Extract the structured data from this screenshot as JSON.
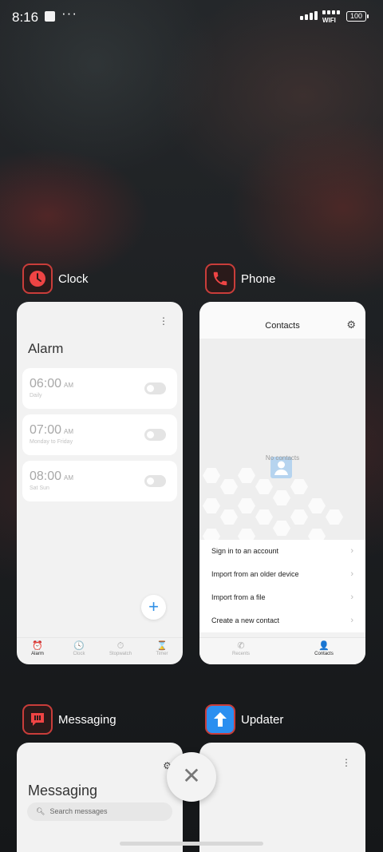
{
  "status_bar": {
    "time": "8:16",
    "more": "···",
    "wifi_label": "WIFI",
    "battery": "100"
  },
  "apps": {
    "clock": {
      "name": "Clock",
      "icon": "clock-icon",
      "icon_color": "#e9433f",
      "menu": "⋮",
      "title": "Alarm",
      "alarms": [
        {
          "time": "06:00",
          "ampm": "AM",
          "repeat": "Daily"
        },
        {
          "time": "07:00",
          "ampm": "AM",
          "repeat": "Monday to Friday"
        },
        {
          "time": "08:00",
          "ampm": "AM",
          "repeat": "Sat Sun"
        }
      ],
      "fab": "+",
      "nav": [
        {
          "label": "Alarm",
          "icon": "⏰"
        },
        {
          "label": "Clock",
          "icon": "🕓"
        },
        {
          "label": "Stopwatch",
          "icon": "⏱"
        },
        {
          "label": "Timer",
          "icon": "⌛"
        }
      ]
    },
    "phone": {
      "name": "Phone",
      "icon": "phone-icon",
      "icon_color": "#e9433f",
      "title": "Contacts",
      "gear": "⚙",
      "empty_text": "No contacts",
      "actions": [
        {
          "label": "Sign in to an account"
        },
        {
          "label": "Import from an older device"
        },
        {
          "label": "Import from a file"
        },
        {
          "label": "Create a new contact"
        }
      ],
      "nav": [
        {
          "label": "Recents",
          "icon": "✆"
        },
        {
          "label": "Contacts",
          "icon": "👤"
        }
      ]
    },
    "messaging": {
      "name": "Messaging",
      "icon": "message-icon",
      "icon_color": "#e9433f",
      "gear": "⚙",
      "title": "Messaging",
      "search_placeholder": "Search messages"
    },
    "updater": {
      "name": "Updater",
      "icon": "upload-arrow-icon",
      "icon_color": "#2b8ff0",
      "menu": "⋮"
    }
  },
  "close_button": "✕",
  "colors": {
    "accent_blue": "#2f8fe6",
    "brand_red": "#e9433f"
  }
}
